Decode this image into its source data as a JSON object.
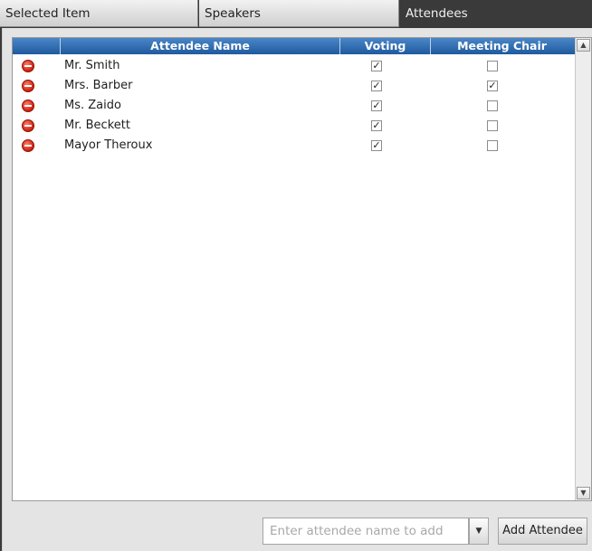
{
  "tabs": [
    {
      "label": "Selected Item",
      "active": false
    },
    {
      "label": "Speakers",
      "active": false
    },
    {
      "label": "Attendees",
      "active": true
    }
  ],
  "grid": {
    "columns": {
      "name": "Attendee Name",
      "voting": "Voting",
      "chair": "Meeting Chair"
    },
    "rows": [
      {
        "name": "Mr. Smith",
        "voting": true,
        "chair": false
      },
      {
        "name": "Mrs. Barber",
        "voting": true,
        "chair": true
      },
      {
        "name": "Ms. Zaido",
        "voting": true,
        "chair": false
      },
      {
        "name": "Mr. Beckett",
        "voting": true,
        "chair": false
      },
      {
        "name": "Mayor Theroux",
        "voting": true,
        "chair": false
      }
    ]
  },
  "add": {
    "placeholder": "Enter attendee name to add",
    "value": "",
    "button_label": "Add Attendee"
  },
  "icons": {
    "remove": "remove-icon",
    "scroll_up": "chevron-up-icon",
    "scroll_down": "chevron-down-icon",
    "dropdown": "chevron-down-icon"
  },
  "colors": {
    "header_top": "#4a86c7",
    "header_bottom": "#1f5a9e",
    "remove_red": "#d2200e",
    "background_dark": "#3a3a3a"
  }
}
